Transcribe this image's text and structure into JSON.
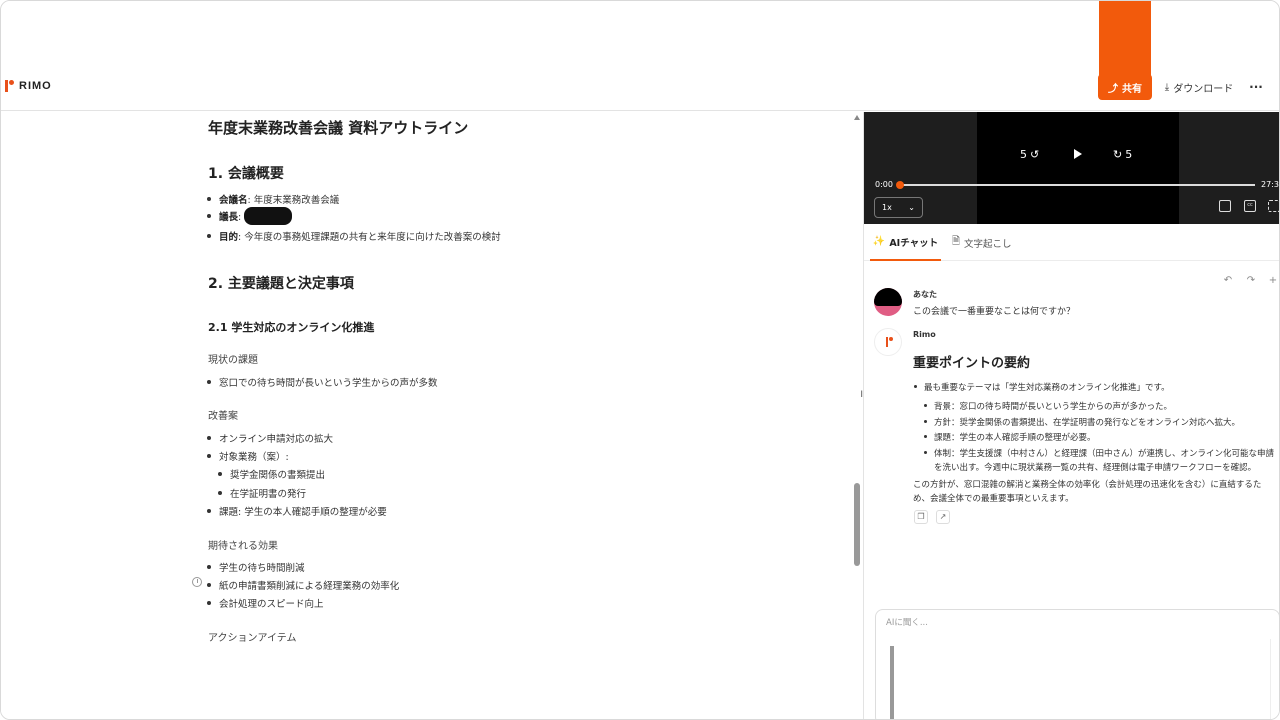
{
  "header": {
    "logo": "RIMO",
    "share_label": "共有",
    "download_label": "ダウンロード",
    "more_label": "···"
  },
  "doc": {
    "title": "年度末業務改善会議 資料アウトライン",
    "section1": {
      "heading": "1. 会議概要",
      "items": [
        {
          "key": "会議名",
          "value": ": 年度末業務改善会議"
        },
        {
          "key": "議長",
          "value": ":"
        },
        {
          "key": "目的",
          "value": ": 今年度の事務処理課題の共有と来年度に向けた改善案の検討"
        }
      ]
    },
    "section2": {
      "heading": "2. 主要議題と決定事項",
      "sub1": "2.1 学生対応のオンライン化推進",
      "current_label": "現状の課題",
      "current_items": [
        "窓口での待ち時間が長いという学生からの声が多数"
      ],
      "plan_label": "改善案",
      "plan_items": [
        "オンライン申請対応の拡大",
        "対象業務（案）:"
      ],
      "plan_subitems": [
        "奨学金関係の書類提出",
        "在学証明書の発行"
      ],
      "plan_issue": "課題: 学生の本人確認手順の整理が必要",
      "effect_label": "期待される効果",
      "effect_items": [
        "学生の待ち時間削減",
        "紙の申請書類削減による経理業務の効率化",
        "会計処理のスピード向上"
      ],
      "action_label": "アクションアイテム"
    }
  },
  "video": {
    "rewind_label": "5",
    "forward_label": "5",
    "time_current": "0:00",
    "time_total": "27:37",
    "progress": 0.0,
    "speed": "1x"
  },
  "tabs": [
    {
      "label": "AIチャット",
      "icon": "sparkle-icon"
    },
    {
      "label": "文字起こし",
      "icon": "document-icon"
    }
  ],
  "chat": {
    "user_name": "あなた",
    "user_message": "この会議で一番重要なことは何ですか？",
    "bot_name": "Rimo",
    "answer_title": "重要ポイントの要約",
    "answer_main": "最も重要なテーマは「学生対応業務のオンライン化推進」です。",
    "answer_points": [
      "背景：窓口の待ち時間が長いという学生からの声が多かった。",
      "方針：奨学金関係の書類提出、在学証明書の発行などをオンライン対応へ拡大。",
      "課題：学生の本人確認手順の整理が必要。",
      "体制：学生支援課（中村さん）と経理課（田中さん）が連携し、オンライン化可能な申請",
      "を洗い出す。今週中に現状業務一覧の共有、経理側は電子申請ワークフローを確認。"
    ],
    "answer_conclusion_1": "この方針が、窓口混雑の解消と業務全体の効率化（会計処理の迅速化を含む）に直結するた",
    "answer_conclusion_2": "め、会議全体での最重要事項といえます。",
    "input_placeholder": "AIに聞く..."
  },
  "colors": {
    "accent": "#f25a0c"
  }
}
